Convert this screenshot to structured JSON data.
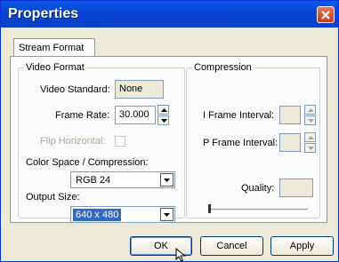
{
  "window": {
    "title": "Properties"
  },
  "tabs": [
    {
      "label": "Stream Format"
    }
  ],
  "video_format": {
    "legend": "Video Format",
    "video_standard_label": "Video Standard:",
    "video_standard_value": "None",
    "frame_rate_label": "Frame Rate:",
    "frame_rate_value": "30.000",
    "flip_horizontal_label": "Flip Horizontal:",
    "color_space_label": "Color Space / Compression:",
    "color_space_value": "RGB 24",
    "output_size_label": "Output Size:",
    "output_size_value": "640 x 480"
  },
  "compression": {
    "legend": "Compression",
    "i_frame_label": "I Frame Interval:",
    "i_frame_value": "",
    "p_frame_label": "P Frame Interval:",
    "p_frame_value": "",
    "quality_label": "Quality:",
    "quality_value": "",
    "quality_level": 0
  },
  "buttons": {
    "ok": "OK",
    "cancel": "Cancel",
    "apply": "Apply"
  },
  "colors": {
    "titlebar": "#0845d6",
    "selection": "#316ac5",
    "close": "#c3381a"
  },
  "icons": {
    "close": "close-icon",
    "spin_up": "arrow-up-icon",
    "spin_down": "arrow-down-icon",
    "dropdown": "chevron-down-icon",
    "cursor": "mouse-pointer-icon"
  }
}
